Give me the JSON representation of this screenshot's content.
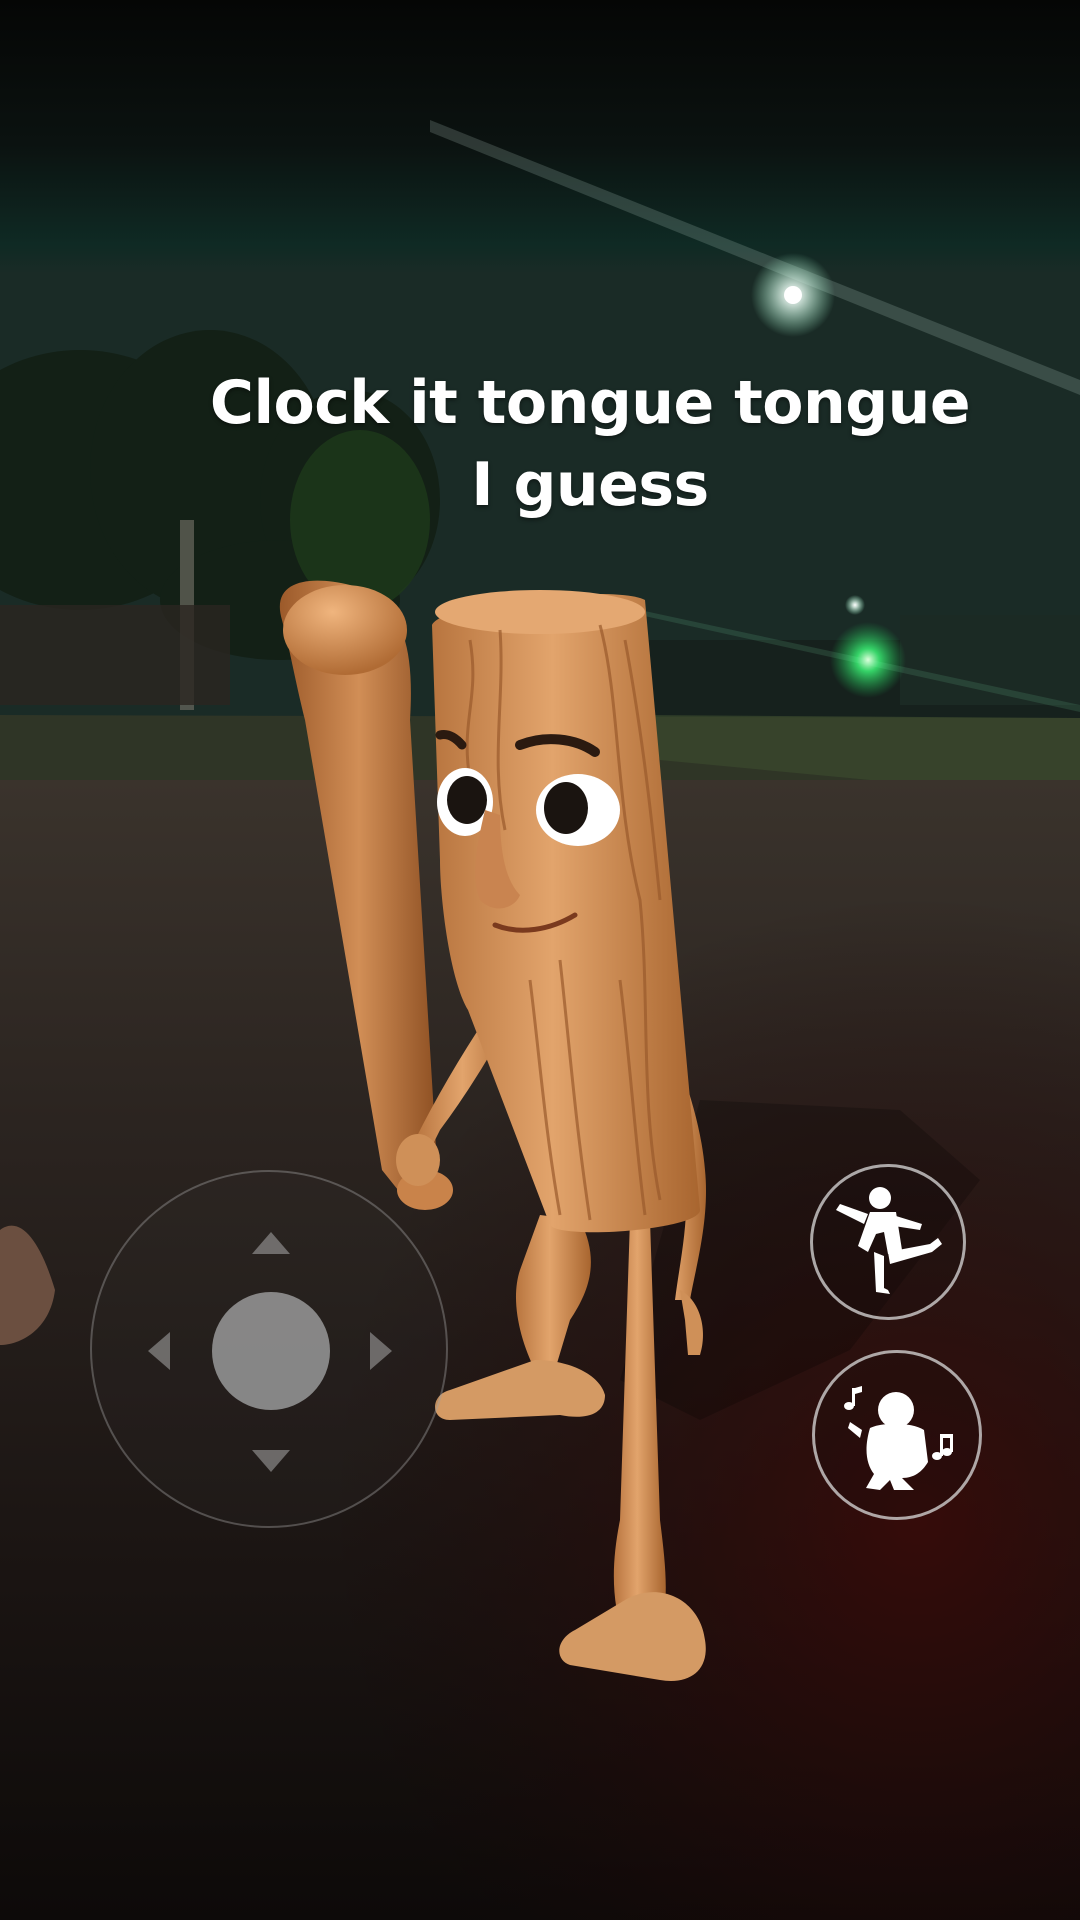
{
  "caption": {
    "line1": "Clock it tongue tongue",
    "line2": "I guess"
  },
  "controls": {
    "joystick": {
      "icon_up": "arrow-up-icon",
      "icon_down": "arrow-down-icon",
      "icon_left": "arrow-left-icon",
      "icon_right": "arrow-right-icon"
    },
    "emote_buttons": [
      {
        "name": "dance-emote",
        "icon": "dancing-figure-icon"
      },
      {
        "name": "sing-emote",
        "icon": "singing-figure-music-notes-icon"
      }
    ]
  },
  "colors": {
    "skin": "#d9975f",
    "street_light": "#ffffff",
    "green_light": "#33ff88",
    "sky": "#0a1412"
  }
}
